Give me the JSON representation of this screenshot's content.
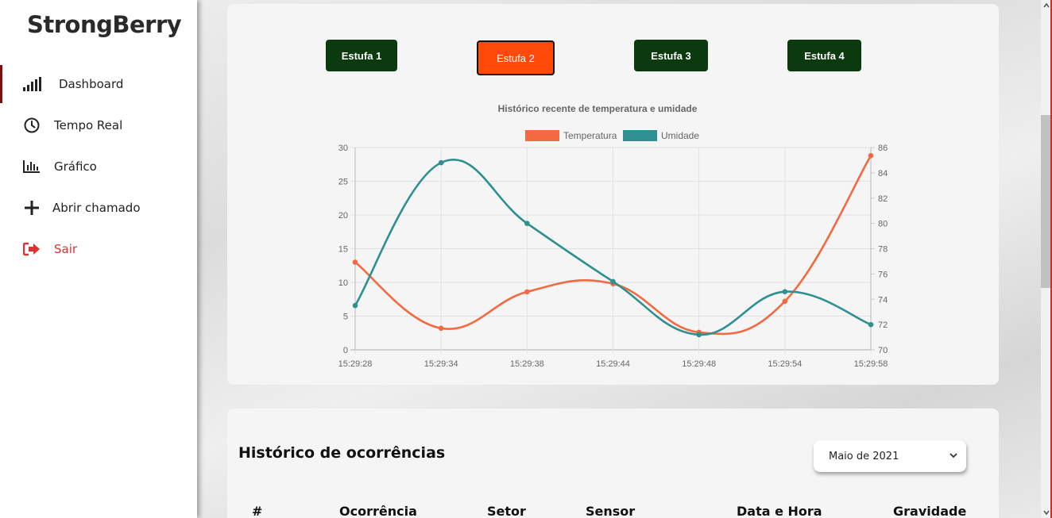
{
  "sidebar": {
    "brand": "StrongBerry",
    "items": [
      {
        "label": "Dashboard",
        "icon": "signal-bars-icon"
      },
      {
        "label": "Tempo Real",
        "icon": "clock-icon"
      },
      {
        "label": "Gráfico",
        "icon": "bar-chart-icon"
      },
      {
        "label": "Abrir chamado",
        "icon": "plus-icon"
      },
      {
        "label": "Sair",
        "icon": "sign-out-icon"
      }
    ]
  },
  "estufas": {
    "e1": "Estufa 1",
    "e2": "Estufa 2",
    "e3": "Estufa 3",
    "e4": "Estufa 4",
    "active": "Estufa 2"
  },
  "colors": {
    "temperatura": "#f36a41",
    "umidade": "#2e9090",
    "active_button": "#ff4a0a",
    "button": "#0b3a0f",
    "logout": "#e03030"
  },
  "chart_data": {
    "type": "line",
    "title": "Histórico recente de temperatura e umidade",
    "x": [
      "15:29:28",
      "15:29:34",
      "15:29:38",
      "15:29:44",
      "15:29:48",
      "15:29:54",
      "15:29:58"
    ],
    "series": [
      {
        "name": "Temperatura",
        "axis": "left",
        "values": [
          13,
          3.2,
          8.6,
          9.8,
          2.6,
          7.2,
          28.8
        ]
      },
      {
        "name": "Umidade",
        "axis": "right",
        "values": [
          73.5,
          84.8,
          80.0,
          75.4,
          71.2,
          74.6,
          72.0
        ]
      }
    ],
    "y_left": {
      "range": [
        0,
        30
      ],
      "ticks": [
        "0",
        "5",
        "10",
        "15",
        "20",
        "25",
        "30"
      ]
    },
    "y_right": {
      "range": [
        70,
        86
      ],
      "ticks": [
        "70",
        "72",
        "74",
        "76",
        "78",
        "80",
        "82",
        "84",
        "86"
      ]
    },
    "legend_position": "top",
    "grid": true
  },
  "ocorrencias": {
    "title": "Histórico de ocorrências",
    "month_selected": "Maio de 2021",
    "columns": [
      "#",
      "Ocorrência",
      "Setor",
      "Sensor",
      "Data e Hora",
      "Gravidade"
    ]
  }
}
